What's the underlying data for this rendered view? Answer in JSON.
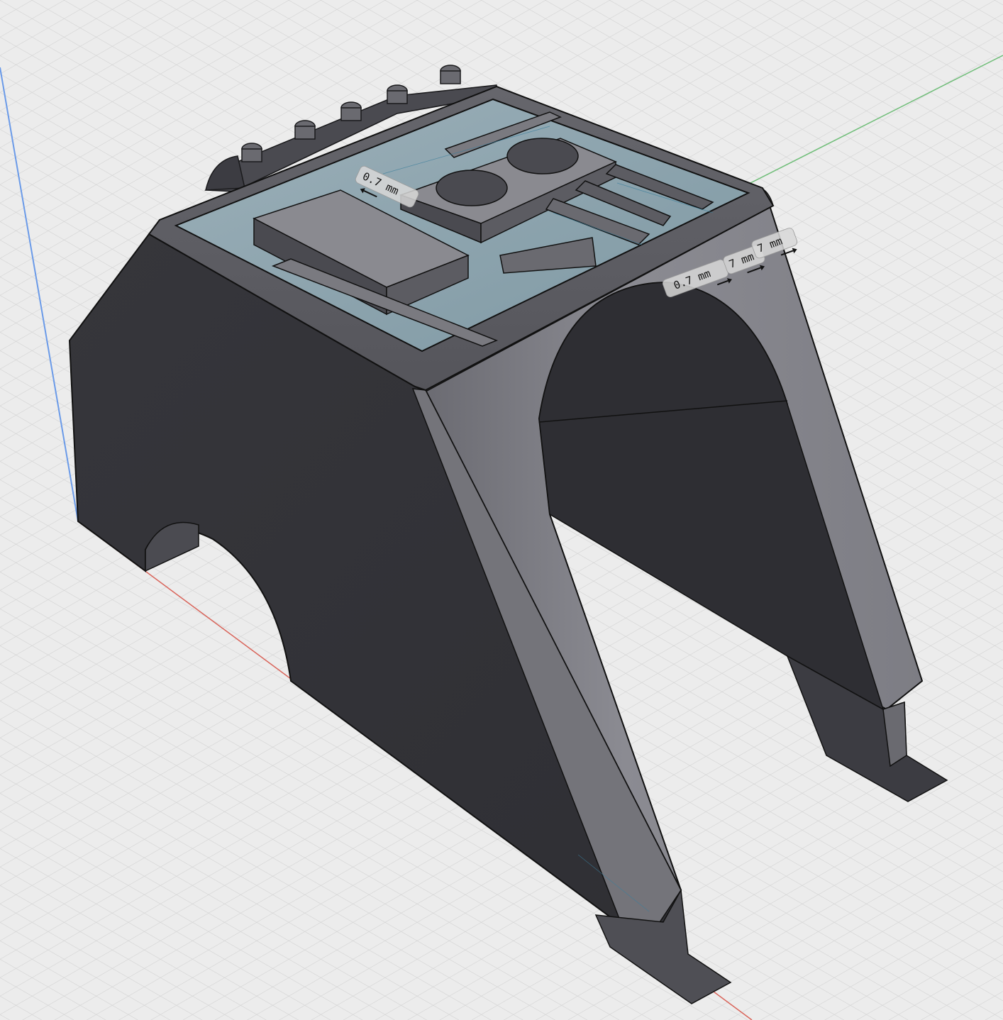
{
  "viewport": {
    "background_color": "#ececec",
    "grid_color": "#c9c9c9",
    "model_color": "#3a3a3f",
    "model_light_color": "#8a8a90",
    "pocket_color": "#8aa4ae",
    "axes": {
      "x_color": "#d9645a",
      "y_color": "#6fbd78",
      "z_color": "#6a9ae8"
    }
  },
  "dimensions": {
    "d1": "0.7 mm",
    "d2": "0.7 mm",
    "d3": "7 mm",
    "d4": "7 mm"
  }
}
